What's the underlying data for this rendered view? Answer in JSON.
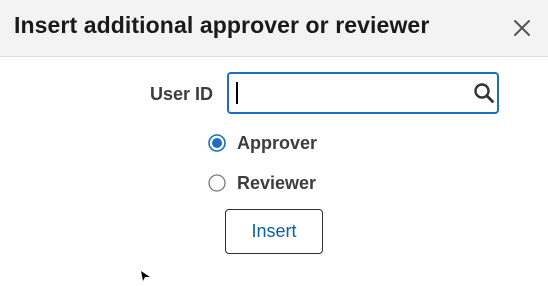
{
  "dialog": {
    "title": "Insert additional approver or reviewer"
  },
  "icons": {
    "close": "close-icon",
    "search": "search-icon"
  },
  "form": {
    "user_id_label": "User ID",
    "user_id_value": "",
    "user_id_placeholder": "",
    "roles": [
      {
        "label": "Approver",
        "selected": true
      },
      {
        "label": "Reviewer",
        "selected": false
      }
    ],
    "insert_label": "Insert"
  },
  "colors": {
    "accent": "#1b6ec2",
    "button_text": "#0b5fa5",
    "header_bg": "#f3f3f3"
  }
}
